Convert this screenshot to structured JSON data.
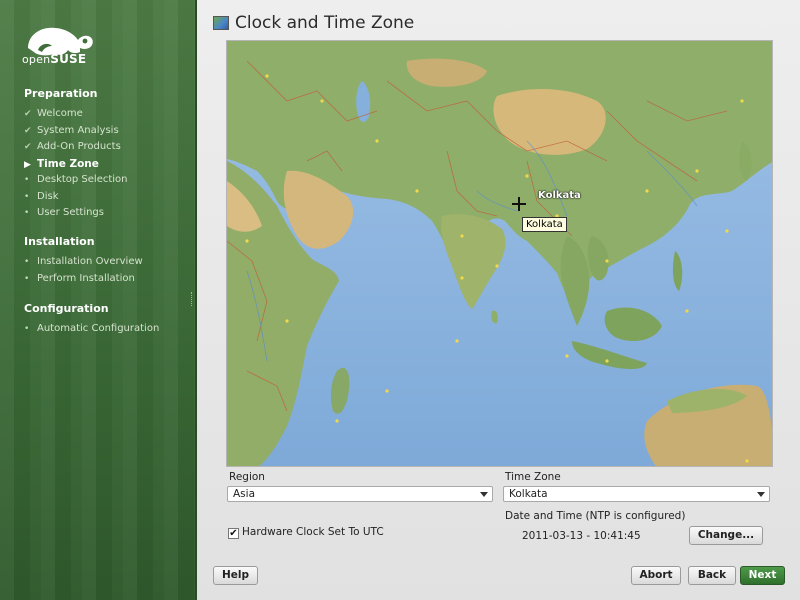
{
  "brand": {
    "logo_text_prefix": "open",
    "logo_text_suffix": "SUSE",
    "logo_color": "#ffffff"
  },
  "sidebar": {
    "sections": [
      {
        "title": "Preparation",
        "steps": [
          {
            "label": "Welcome",
            "state": "done"
          },
          {
            "label": "System Analysis",
            "state": "done"
          },
          {
            "label": "Add-On Products",
            "state": "done"
          },
          {
            "label": "Time Zone",
            "state": "current"
          },
          {
            "label": "Desktop Selection",
            "state": "pending"
          },
          {
            "label": "Disk",
            "state": "pending"
          },
          {
            "label": "User Settings",
            "state": "pending"
          }
        ]
      },
      {
        "title": "Installation",
        "steps": [
          {
            "label": "Installation Overview",
            "state": "pending"
          },
          {
            "label": "Perform Installation",
            "state": "pending"
          }
        ]
      },
      {
        "title": "Configuration",
        "steps": [
          {
            "label": "Automatic Configuration",
            "state": "pending"
          }
        ]
      }
    ]
  },
  "page": {
    "title": "Clock and Time Zone",
    "title_icon": "globe-icon"
  },
  "map": {
    "selected_city": "Kolkata",
    "tooltip": "Kolkata",
    "colors": {
      "ocean": "#8fb6df",
      "land": "#8fae6a",
      "desert": "#d6b97a",
      "mountain": "#b89a66",
      "border": "#c0603a"
    }
  },
  "form": {
    "region_label": "Region",
    "region_value": "Asia",
    "timezone_label": "Time Zone",
    "timezone_value": "Kolkata",
    "hw_clock_label": "Hardware Clock Set To UTC",
    "hw_clock_checked": true,
    "date_time_heading": "Date and Time (NTP is configured)",
    "date_time_value": "2011-03-13 - 10:41:45",
    "change_button": "Change..."
  },
  "buttons": {
    "help": "Help",
    "abort": "Abort",
    "back": "Back",
    "next": "Next"
  },
  "accent_color": "#3f7a3a"
}
